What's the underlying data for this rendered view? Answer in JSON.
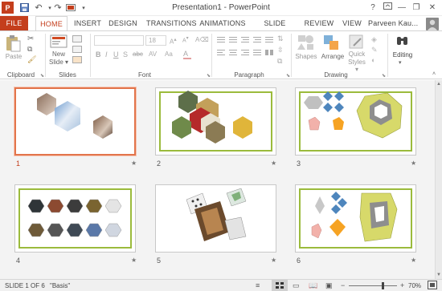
{
  "title": "Presentation1 - PowerPoint",
  "quick_access": {
    "save_icon": "save-icon",
    "undo_icon": "undo-icon",
    "redo_icon": "redo-icon"
  },
  "window_controls": {
    "help": "?",
    "minimize": "—",
    "restore": "❐",
    "close": "✕"
  },
  "tabs": [
    "FILE",
    "HOME",
    "INSERT",
    "DESIGN",
    "TRANSITIONS",
    "ANIMATIONS",
    "SLIDE SHOW",
    "REVIEW",
    "VIEW"
  ],
  "user": "Parveen Kau...",
  "ribbon": {
    "clipboard": {
      "paste": "Paste",
      "label": "Clipboard"
    },
    "slides": {
      "new_slide_line1": "New",
      "new_slide_line2": "Slide ▾",
      "label": "Slides"
    },
    "font": {
      "label": "Font",
      "font_size": "18"
    },
    "paragraph": {
      "label": "Paragraph"
    },
    "drawing": {
      "shapes": "Shapes",
      "arrange": "Arrange",
      "quick_styles_line1": "Quick",
      "quick_styles_line2": "Styles ▾",
      "label": "Drawing"
    },
    "editing": {
      "label": "Editing"
    }
  },
  "slides": [
    {
      "number": "1",
      "star": "★"
    },
    {
      "number": "2",
      "star": "★"
    },
    {
      "number": "3",
      "star": "★"
    },
    {
      "number": "4",
      "star": "★"
    },
    {
      "number": "5",
      "star": "★"
    },
    {
      "number": "6",
      "star": "★"
    }
  ],
  "status": {
    "slide_info": "SLIDE 1 OF 6",
    "theme": "\"Basis\"",
    "zoom": "70%",
    "zoom_level": 0.7
  },
  "colors": {
    "accent": "#c43e1c",
    "slide_border": "#9bbb3c",
    "selection": "#e2754c"
  }
}
